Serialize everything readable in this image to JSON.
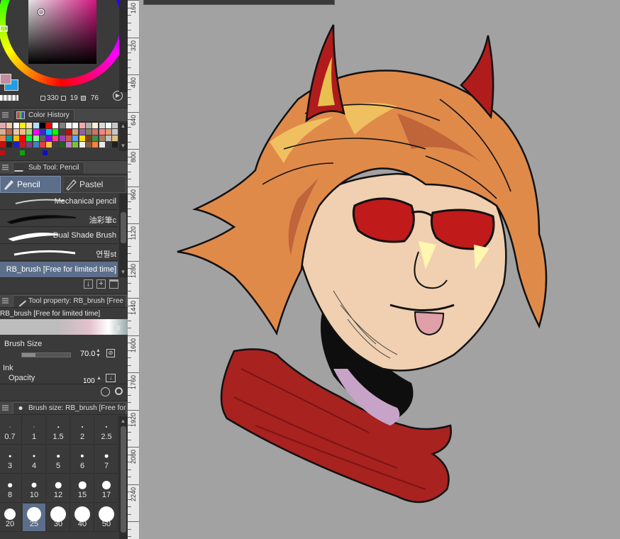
{
  "color_wheel": {
    "hsv": {
      "h": "330",
      "s": "19",
      "v": "76"
    },
    "colors": {
      "main": "#c28e9d",
      "sub": "#1fa0e6",
      "square_hue": "#e8178e"
    }
  },
  "color_history": {
    "tab_label": "Color History",
    "swatches": [
      [
        "#e8a8b0",
        "#f4c8a8",
        "#ffffff",
        "#fff200",
        "#ffe0b0",
        "#b0e0ff",
        "#000000",
        "#ff0000",
        "#ffffff",
        "#808080",
        "#f0f0f0",
        "#ffffff",
        "#f4a8a8",
        "#b0b0b0",
        "#fff0d8",
        "#d8d8d8",
        "#f8f8f8",
        "#c8c8c8"
      ],
      [
        "#d4b090",
        "#c86448",
        "#e8c8a8",
        "#f4b890",
        "#a0e070",
        "#ff00ff",
        "#3030c0",
        "#00c0ff",
        "#00ff00",
        "#404040",
        "#c01010",
        "#d4a070",
        "#9060a0",
        "#808060",
        "#d07070",
        "#ff8080",
        "#e0a070",
        "#c8c8c8"
      ],
      [
        "#f08040",
        "#00a0a0",
        "#ffc000",
        "#ff0000",
        "#00ff40",
        "#80ff80",
        "#606060",
        "#8000ff",
        "#ff4080",
        "#a040c0",
        "#c06040",
        "#60a0ff",
        "#ffe000",
        "#804020",
        "#409040",
        "#a08060",
        "#c0c0c0",
        "#e0c080"
      ],
      [
        "#c01010",
        "#202020",
        "#2020c0",
        "#c02020",
        "#804080",
        "#4080c0",
        "#e04040",
        "#ffc040",
        "#404040",
        "#206020",
        "#c080c0",
        "#80c040",
        "#f0f0f0",
        "#806040",
        "#ff8040",
        "#e8e8e8",
        "#404040",
        "#202020"
      ]
    ],
    "dots": [
      "#c01010",
      "#10a010",
      "#1010c0"
    ]
  },
  "sub_tool": {
    "tab_label": "Sub Tool: Pencil",
    "groups": [
      {
        "label": "Pencil",
        "selected": true
      },
      {
        "label": "Pastel",
        "selected": false
      }
    ],
    "brushes": [
      {
        "label": "Mechanical pencil",
        "selected": false
      },
      {
        "label": "油彩筆c",
        "selected": false
      },
      {
        "label": "Dual Shade Brush",
        "selected": false
      },
      {
        "label": "연필st",
        "selected": false
      },
      {
        "label": "RB_brush [Free for limited time]",
        "selected": true
      }
    ]
  },
  "tool_property": {
    "tab_label": "Tool property: RB_brush [Free fo",
    "brush_name": "RB_brush [Free for limited time]",
    "brush_size_label": "Brush Size",
    "brush_size_value": "70.0",
    "brush_size_fraction": 0.28,
    "ink_label": "Ink",
    "opacity_label": "Opacity",
    "opacity_value": "100"
  },
  "brush_size_palette": {
    "tab_label": "Brush size: RB_brush [Free for li",
    "sizes": [
      "0.7",
      "1",
      "1.5",
      "2",
      "2.5",
      "3",
      "4",
      "5",
      "6",
      "7",
      "8",
      "10",
      "12",
      "15",
      "17",
      "20",
      "25",
      "30",
      "40",
      "50"
    ],
    "selected": "25"
  },
  "ruler": {
    "labels": [
      "160",
      "320",
      "480",
      "640",
      "800",
      "960",
      "1120",
      "1280",
      "1440",
      "1600",
      "1760",
      "1920",
      "2080",
      "2240"
    ]
  },
  "canvas": {
    "background": "#a2a2a2"
  }
}
